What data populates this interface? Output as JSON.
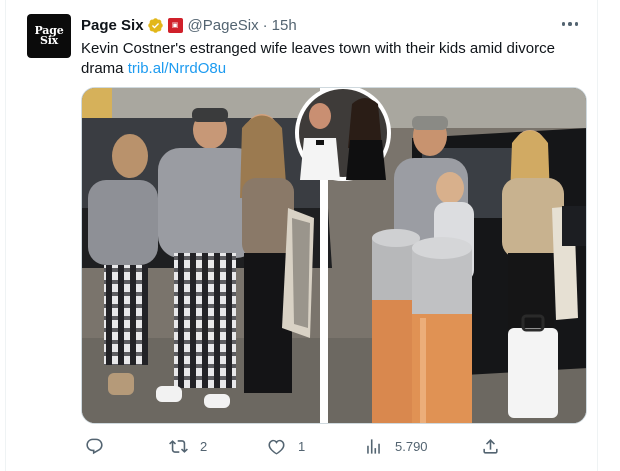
{
  "tweet": {
    "avatar_text": [
      "Page",
      "Six"
    ],
    "display_name": "Page Six",
    "handle": "@PageSix",
    "separator": "·",
    "time": "15h",
    "text": "Kevin Costner's estranged wife leaves town with their kids amid divorce drama",
    "link": "trib.al/NrrdO8u",
    "icons": {
      "verified": "gold-verified-badge-icon",
      "affiliation": "page-six-affiliate-badge-icon",
      "more": "more-options-icon"
    }
  },
  "media": {
    "description_icons": [
      "photo-of-family-at-airport",
      "inset-couple-portrait"
    ]
  },
  "actions": {
    "reply": {
      "icon": "reply-icon",
      "count": ""
    },
    "retweet": {
      "icon": "retweet-icon",
      "count": "2"
    },
    "like": {
      "icon": "heart-icon",
      "count": "1"
    },
    "views": {
      "icon": "views-chart-icon",
      "count": "5.790"
    },
    "share": {
      "icon": "share-icon",
      "count": ""
    }
  },
  "colors": {
    "text": "#0f1419",
    "secondary": "#536471",
    "link": "#1d9bf0",
    "verified_gold": "#e2b719",
    "affiliate_red": "#d0202a"
  }
}
